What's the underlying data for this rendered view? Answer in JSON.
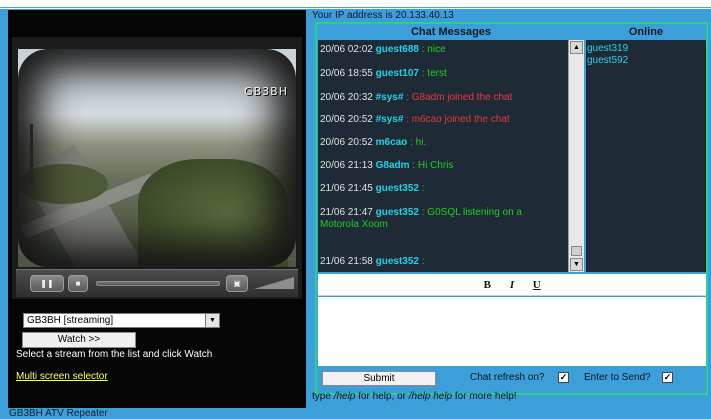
{
  "ip_text": "Your IP address is 20.133.40.13",
  "left": {
    "camera_overlay": "GB3BH",
    "player": {
      "pause_glyph": "❚❚",
      "stop_glyph": "■",
      "fullscreen_glyph": "▣"
    },
    "stream_select": {
      "value": "GB3BH [streaming]",
      "arrow": "▼"
    },
    "watch_label": "Watch >>",
    "select_hint": "Select a stream from the list and click Watch",
    "multi_link": "Multi screen selector"
  },
  "footer": "GB3BH ATV Repeater",
  "chat": {
    "header": "Chat Messages",
    "online_header": "Online",
    "messages": [
      {
        "time": "20/06 02:02",
        "nick": "guest688",
        "text": " : nice"
      },
      {
        "time": "20/06 18:55",
        "nick": "guest107",
        "text": " : terst"
      },
      {
        "time": "20/06 20:32",
        "nick": "#sys#",
        "text": " : G8adm joined the chat"
      },
      {
        "time": "20/06 20:52",
        "nick": "#sys#",
        "text": " : m6cao joined the chat"
      },
      {
        "time": "20/06 20:52",
        "nick": "m6cao",
        "text": " : hi."
      },
      {
        "time": "20/06 21:13",
        "nick": "G8adm",
        "text": " : Hi Chris"
      },
      {
        "time": "21/06 21:45",
        "nick": "guest352",
        "text": " :"
      },
      {
        "time": "21/06 21:47",
        "nick": "guest352",
        "text": " : G0SQL listening on a Motorola Xoom"
      },
      {
        "time": "21/06 21:58",
        "nick": "guest352",
        "text": " :"
      }
    ],
    "online_users": [
      "guest319",
      "guest592"
    ],
    "scroll_up": "▲",
    "scroll_down": "▼",
    "toolbar": {
      "bold": "B",
      "italic": "I",
      "underline": "U"
    },
    "submit_label": "Submit",
    "refresh_label": "Chat refresh on?",
    "enter_label": "Enter to Send?",
    "refresh_checked": true,
    "enter_checked": true,
    "check_mark": "✓",
    "help": {
      "prefix": "type ",
      "cmd1": "/help",
      "middle": " for help, or ",
      "cmd2": "/help help",
      "suffix": " for more help!"
    }
  }
}
